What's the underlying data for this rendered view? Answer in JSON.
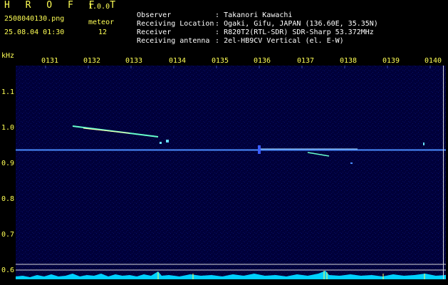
{
  "header": {
    "app_title": "H R O F F T",
    "app_version": "1.0.0",
    "file_name": "2508040130.png",
    "meteor_label": "meteor",
    "date_time": "25.08.04 01:30",
    "meteor_count": "12"
  },
  "info": [
    {
      "key": "Observer",
      "value": ": Takanori Kawachi"
    },
    {
      "key": "Receiving Location",
      "value": ": Ogaki, Gifu, JAPAN (136.60E, 35.35N)"
    },
    {
      "key": "Receiver",
      "value": ": R820T2(RTL-SDR) SDR-Sharp 53.372MHz"
    },
    {
      "key": "Receiving antenna",
      "value": ": 2el-HB9CV Vertical (el. E-W)"
    }
  ],
  "axes": {
    "y_unit": "kHz",
    "x_ticks": [
      "0131",
      "0132",
      "0133",
      "0134",
      "0135",
      "0136",
      "0137",
      "0138",
      "0139",
      "0140"
    ],
    "y_ticks": [
      "1.1",
      "1.0",
      "0.9",
      "0.8",
      "0.7",
      "0.6"
    ]
  },
  "colors": {
    "background": "#000000",
    "spectrum": "#00003a",
    "labels": "#ffff55",
    "carrier": "#4a8cff",
    "echo": "#66ffcc",
    "power": "#00d0ff"
  }
}
